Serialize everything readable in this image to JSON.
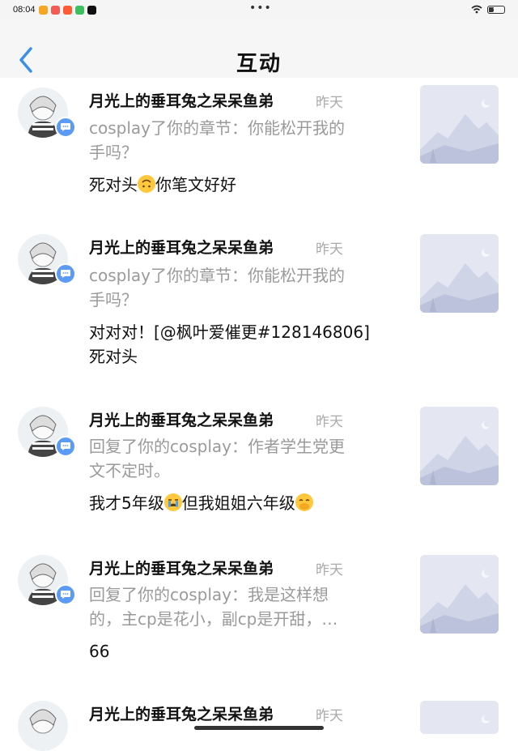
{
  "status_bar": {
    "time": "08:04",
    "dots": "•••",
    "battery": "30",
    "app_colors": [
      "#f5a623",
      "#f25c54",
      "#ff5a36",
      "#3cbf5e",
      "#111111"
    ]
  },
  "nav": {
    "back_icon": "chevron-left-icon",
    "title": "互动",
    "accent": "#3a8fe8"
  },
  "items": [
    {
      "username": "月光上的垂耳兔之呆呆鱼弟",
      "time": "昨天",
      "action_line1": "cosplay了你的章节：你能松开我的",
      "action_line2": "手吗？",
      "reply_pre": "死对头",
      "reply_emoji": "upside-down-face",
      "reply_post": "你笔文好好",
      "reply_line2": ""
    },
    {
      "username": "月光上的垂耳兔之呆呆鱼弟",
      "time": "昨天",
      "action_line1": "cosplay了你的章节：你能松开我的",
      "action_line2": "手吗？",
      "reply_pre": "对对对！[@枫叶爱催更#128146806]",
      "reply_emoji": "",
      "reply_post": "",
      "reply_line2": "死对头"
    },
    {
      "username": "月光上的垂耳兔之呆呆鱼弟",
      "time": "昨天",
      "action_line1": "回复了你的cosplay：作者学生党更",
      "action_line2": "文不定时。",
      "reply_pre": "我才5年级",
      "reply_emoji": "crying-face",
      "reply_post": "但我姐姐六年级",
      "reply_emoji2": "hand-over-mouth-face",
      "reply_line2": ""
    },
    {
      "username": "月光上的垂耳兔之呆呆鱼弟",
      "time": "昨天",
      "action_line1": "回复了你的cosplay：我是这样想",
      "action_line2": "的，主cp是花小，副cp是开甜，…",
      "reply_pre": "66",
      "reply_emoji": "",
      "reply_post": "",
      "reply_line2": ""
    },
    {
      "username": "月光上的垂耳兔之呆呆鱼弟",
      "time": "昨天",
      "action_line1": "",
      "action_line2": "",
      "reply_pre": "",
      "reply_emoji": "",
      "reply_post": "",
      "reply_line2": ""
    }
  ],
  "icons": {
    "avatar": "anime-avatar",
    "badge": "comment-bubble-icon",
    "thumbnail": "landscape-placeholder-icon"
  }
}
